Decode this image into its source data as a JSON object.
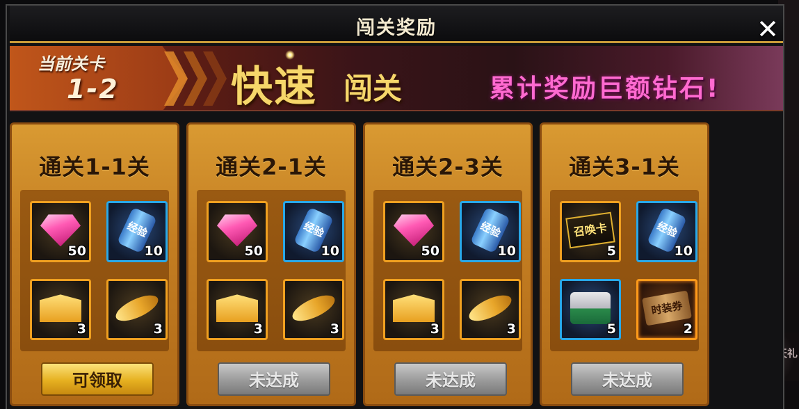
{
  "header": {
    "title": "闯关奖励",
    "close_label": "✕"
  },
  "banner": {
    "current_stage_label": "当前关卡",
    "current_stage_value": "1-2",
    "headline_main": "快速",
    "headline_sub": "闯关",
    "promo_text": "累计奖励巨额钻石!"
  },
  "side_label": "闯天礼",
  "cards": [
    {
      "title": "通关1-1关",
      "button": "可领取",
      "button_state": "claimable",
      "rewards": [
        {
          "icon": "diamond-icon",
          "qty": "50",
          "frame": "gold"
        },
        {
          "icon": "exp-potion-icon",
          "qty": "10",
          "frame": "blue",
          "icon_text": "经验"
        },
        {
          "icon": "gold-envelope-icon",
          "qty": "3",
          "frame": "gold"
        },
        {
          "icon": "gold-feather-icon",
          "qty": "3",
          "frame": "gold"
        }
      ]
    },
    {
      "title": "通关2-1关",
      "button": "未达成",
      "button_state": "locked",
      "rewards": [
        {
          "icon": "diamond-icon",
          "qty": "50",
          "frame": "gold"
        },
        {
          "icon": "exp-potion-icon",
          "qty": "10",
          "frame": "blue",
          "icon_text": "经验"
        },
        {
          "icon": "gold-envelope-icon",
          "qty": "3",
          "frame": "gold"
        },
        {
          "icon": "gold-feather-icon",
          "qty": "3",
          "frame": "gold"
        }
      ]
    },
    {
      "title": "通关2-3关",
      "button": "未达成",
      "button_state": "locked",
      "rewards": [
        {
          "icon": "diamond-icon",
          "qty": "50",
          "frame": "gold"
        },
        {
          "icon": "exp-potion-icon",
          "qty": "10",
          "frame": "blue",
          "icon_text": "经验"
        },
        {
          "icon": "gold-envelope-icon",
          "qty": "3",
          "frame": "gold"
        },
        {
          "icon": "gold-feather-icon",
          "qty": "3",
          "frame": "gold"
        }
      ]
    },
    {
      "title": "通关3-1关",
      "button": "未达成",
      "button_state": "locked",
      "rewards": [
        {
          "icon": "summon-card-icon",
          "qty": "5",
          "frame": "gold",
          "icon_text": "召唤卡"
        },
        {
          "icon": "exp-potion-icon",
          "qty": "10",
          "frame": "blue",
          "icon_text": "经验"
        },
        {
          "icon": "chest-icon",
          "qty": "5",
          "frame": "blue"
        },
        {
          "icon": "fashion-ticket-icon",
          "qty": "2",
          "frame": "orange",
          "icon_text": "时装券"
        }
      ]
    }
  ],
  "colors": {
    "claim_button": "#e6b020",
    "locked_button": "#9a9a9a",
    "card_gold": "#c47e22",
    "promo_pink": "#ff6ad0"
  }
}
